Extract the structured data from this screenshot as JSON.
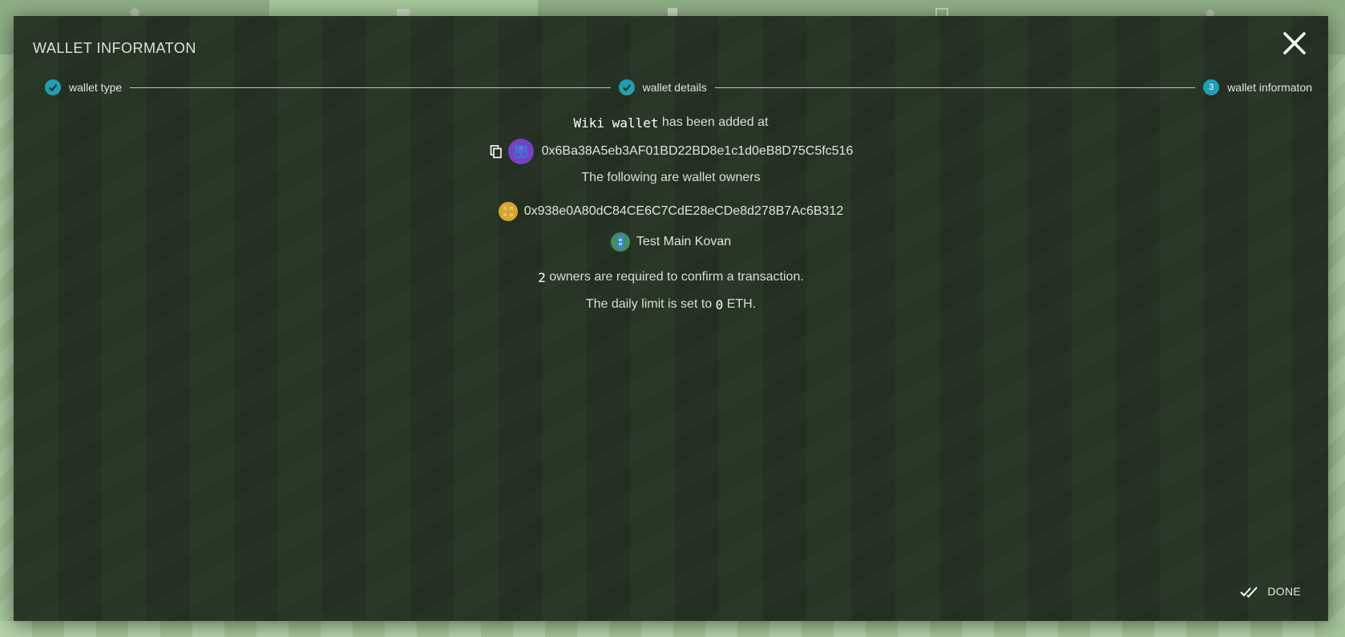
{
  "background": {
    "tabs": [
      {
        "icon": "home-icon",
        "active": false
      },
      {
        "icon": "account-icon",
        "active": true
      },
      {
        "icon": "address-book-icon",
        "active": false
      },
      {
        "icon": "apps-icon",
        "active": false
      },
      {
        "icon": "settings-icon",
        "active": false
      }
    ]
  },
  "modal": {
    "title": "WALLET INFORMATON",
    "close_icon": "close-icon"
  },
  "stepper": {
    "steps": [
      {
        "label": "wallet type",
        "state": "complete"
      },
      {
        "label": "wallet details",
        "state": "complete"
      },
      {
        "label": "wallet informaton",
        "state": "active",
        "number": "3"
      }
    ]
  },
  "content": {
    "wallet_name": "Wiki wallet",
    "added_text": "has been added at",
    "wallet_address": "0x6Ba38A5eb3AF01BD22BD8e1c1d0eB8D75C5fc516",
    "owners_heading": "The following are wallet owners",
    "owners": [
      {
        "address": "0x938e0A80dC84CE6C7CdE28eCDe8d278B7Ac6B312",
        "identicon_color": "#d6a630"
      },
      {
        "address": "Test Main Kovan",
        "identicon_color": "#3f8f5f"
      }
    ],
    "required_count": "2",
    "required_text": "owners are required to confirm a transaction.",
    "daily_limit_prefix": "The daily limit is set to",
    "daily_limit_value": "0",
    "daily_limit_unit": "ETH."
  },
  "actions": {
    "done_label": "DONE"
  },
  "colors": {
    "modal_bg": "#243222",
    "accent": "#1f9fb3",
    "page_bg": "#a6c79b"
  }
}
